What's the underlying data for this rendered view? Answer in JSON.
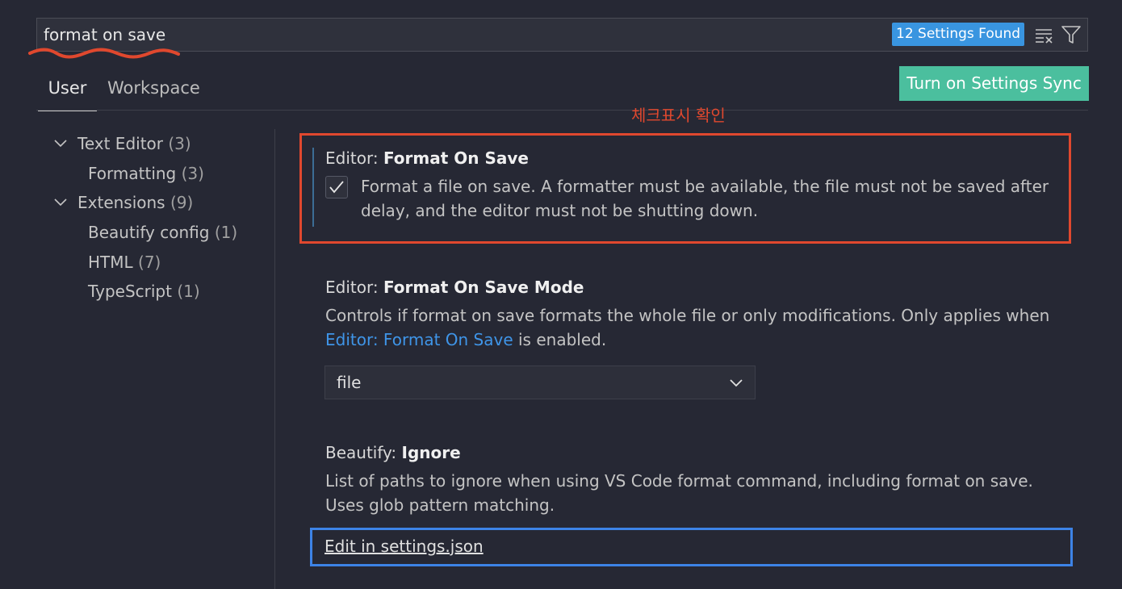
{
  "search": {
    "value": "format on save",
    "badge": "12 Settings Found",
    "clear_icon": "clear-filter-icon",
    "filter_icon": "filter-icon"
  },
  "tabs": [
    {
      "label": "User",
      "active": true
    },
    {
      "label": "Workspace",
      "active": false
    }
  ],
  "sync_button": "Turn on Settings Sync",
  "toc": [
    {
      "label": "Text Editor",
      "count": "(3)",
      "expanded": true
    },
    {
      "label": "Formatting",
      "count": "(3)"
    },
    {
      "label": "Extensions",
      "count": "(9)",
      "expanded": true
    },
    {
      "label": "Beautify config",
      "count": "(1)"
    },
    {
      "label": "HTML",
      "count": "(7)"
    },
    {
      "label": "TypeScript",
      "count": "(1)"
    }
  ],
  "annotation": "체크표시 확인",
  "settings": {
    "format_on_save": {
      "category": "Editor: ",
      "name": "Format On Save",
      "checked": true,
      "description": "Format a file on save. A formatter must be available, the file must not be saved after delay, and the editor must not be shutting down."
    },
    "format_on_save_mode": {
      "category": "Editor: ",
      "name": "Format On Save Mode",
      "description_line1": "Controls if format on save formats the whole file or only modifications. Only applies when",
      "link": "Editor: Format On Save",
      "description_tail": " is enabled.",
      "selected": "file"
    },
    "beautify_ignore": {
      "category": "Beautify: ",
      "name": "Ignore",
      "description": "List of paths to ignore when using VS Code format command, including format on save. Uses glob pattern matching.",
      "edit_link": "Edit in settings.json"
    }
  },
  "colors": {
    "background": "#262834",
    "badge": "#3995e0",
    "sync_button": "#4bbf9e",
    "annotation_red": "#e0482e",
    "annotation_blue": "#3d83e6",
    "link": "#3f95e8"
  }
}
